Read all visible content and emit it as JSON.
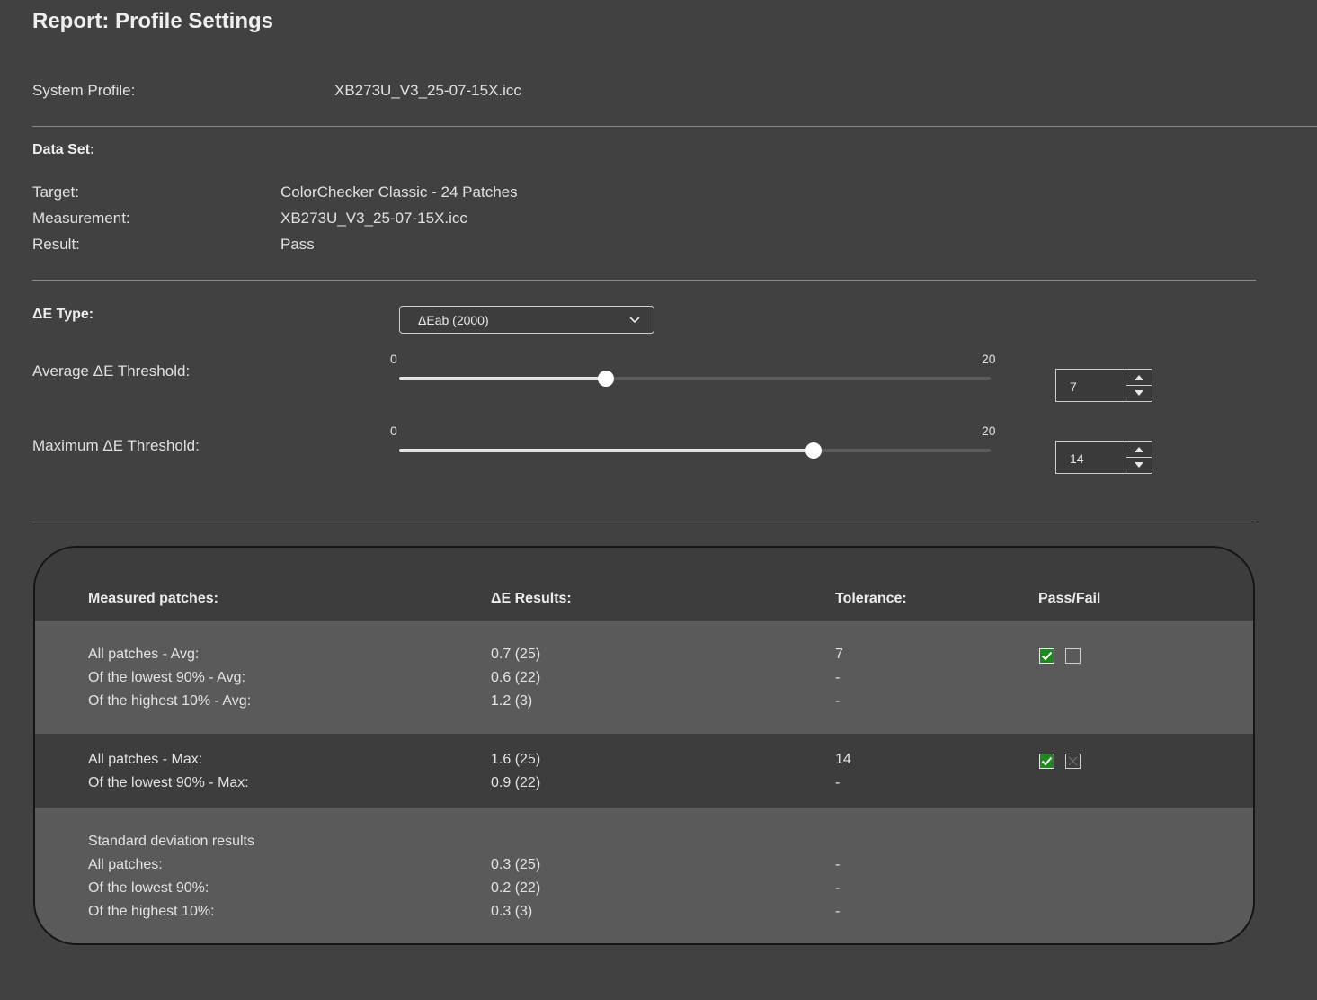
{
  "title": "Report: Profile Settings",
  "system_profile": {
    "label": "System Profile:",
    "value": "XB273U_V3_25-07-15X.icc"
  },
  "data_set": {
    "heading": "Data Set:",
    "target_label": "Target:",
    "target_value": "ColorChecker Classic - 24 Patches",
    "measurement_label": "Measurement:",
    "measurement_value": "XB273U_V3_25-07-15X.icc",
    "result_label": "Result:",
    "result_value": "Pass"
  },
  "de_type": {
    "label": "ΔE Type:",
    "selected": "ΔEab (2000)"
  },
  "avg_threshold": {
    "label": "Average ΔE Threshold:",
    "min": "0",
    "max": "20",
    "value": "7",
    "fraction": 0.35
  },
  "max_threshold": {
    "label": "Maximum ΔE Threshold:",
    "min": "0",
    "max": "20",
    "value": "14",
    "fraction": 0.7
  },
  "table": {
    "headers": {
      "patches": "Measured patches:",
      "results": "ΔE Results:",
      "tolerance": "Tolerance:",
      "passfail": "Pass/Fail"
    },
    "avg_rows": [
      {
        "label": "All patches - Avg:",
        "result": "0.7 (25)",
        "tolerance": "7"
      },
      {
        "label": "Of the lowest 90% - Avg:",
        "result": "0.6 (22)",
        "tolerance": "-"
      },
      {
        "label": "Of the highest 10% - Avg:",
        "result": "1.2 (3)",
        "tolerance": "-"
      }
    ],
    "max_rows": [
      {
        "label": "All patches - Max:",
        "result": "1.6 (25)",
        "tolerance": "14"
      },
      {
        "label": "Of the lowest 90% - Max:",
        "result": "0.9 (22)",
        "tolerance": "-"
      }
    ],
    "std_heading": "Standard deviation results",
    "std_rows": [
      {
        "label": "All patches:",
        "result": "0.3 (25)",
        "tolerance": "-"
      },
      {
        "label": "Of the lowest 90%:",
        "result": "0.2 (22)",
        "tolerance": "-"
      },
      {
        "label": "Of the highest 10%:",
        "result": "0.3 (3)",
        "tolerance": "-"
      }
    ]
  }
}
